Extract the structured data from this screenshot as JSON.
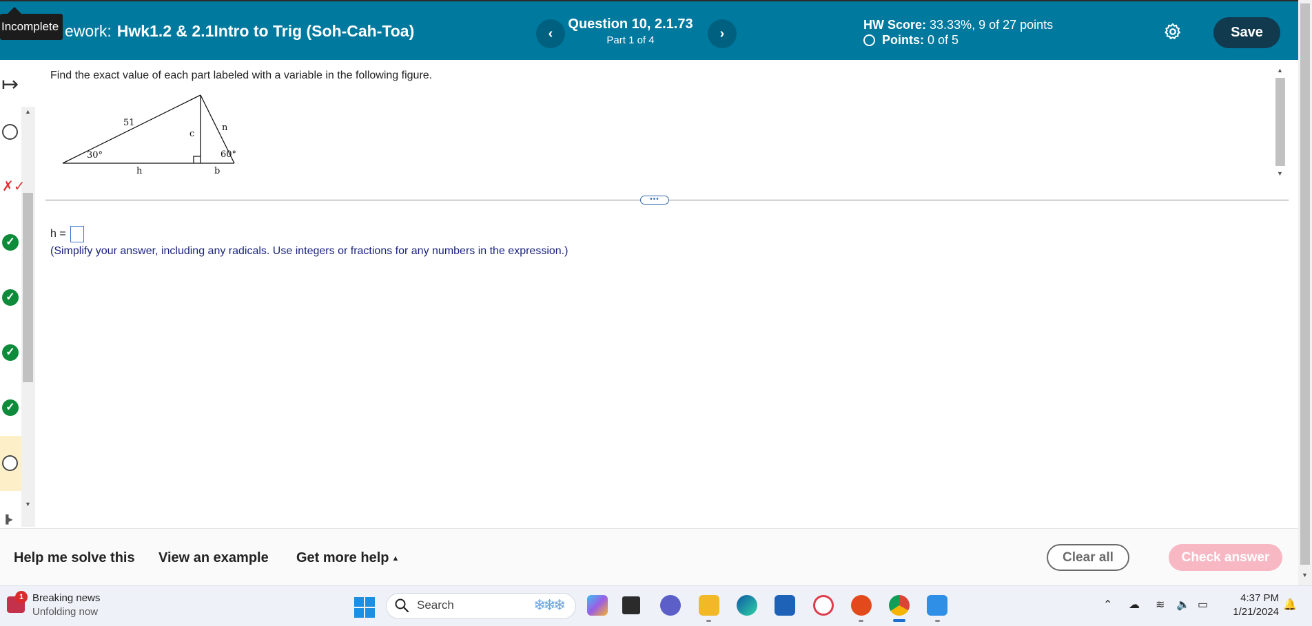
{
  "header": {
    "tooltip": "Incomplete",
    "title_prefix": "ework:",
    "title": "Hwk1.2 & 2.1Intro to Trig (Soh-Cah-Toa)",
    "prev_glyph": "‹",
    "next_glyph": "›",
    "question_title": "Question 10, 2.1.73",
    "question_part": "Part 1 of 4",
    "score_label": "HW Score:",
    "score_value": "33.33%, 9 of 27 points",
    "points_label": "Points:",
    "points_value": "0 of 5",
    "save_label": "Save",
    "settings_icon": "gear-icon",
    "colors": {
      "bar": "#00799e",
      "save": "#113a4f"
    }
  },
  "sidebar": {
    "items": [
      {
        "status": "unanswered"
      },
      {
        "status": "partial",
        "glyph": "✗✓"
      },
      {
        "status": "correct",
        "glyph": "✓"
      },
      {
        "status": "correct",
        "glyph": "✓"
      },
      {
        "status": "correct",
        "glyph": "✓"
      },
      {
        "status": "correct",
        "glyph": "✓"
      },
      {
        "status": "current-unanswered"
      }
    ],
    "collapse_glyph": "↦"
  },
  "question": {
    "prompt": "Find the exact value of each part labeled with a variable in the following figure.",
    "figure": {
      "hyp_label": "51",
      "angle_left": "30°",
      "angle_right": "60°",
      "label_c": "c",
      "label_n": "n",
      "label_h": "h",
      "label_b": "b"
    },
    "answer_label": "h =",
    "hint": "(Simplify your answer, including any radicals. Use integers or fractions for any numbers in the expression.)"
  },
  "footer": {
    "help_solve": "Help me solve this",
    "view_example": "View an example",
    "more_help": "Get more help",
    "clear_all": "Clear all",
    "check_answer": "Check answer"
  },
  "taskbar": {
    "news_badge": "1",
    "news_title": "Breaking news",
    "news_sub": "Unfolding now",
    "search_placeholder": "Search",
    "time": "4:37 PM",
    "date": "1/21/2024"
  }
}
